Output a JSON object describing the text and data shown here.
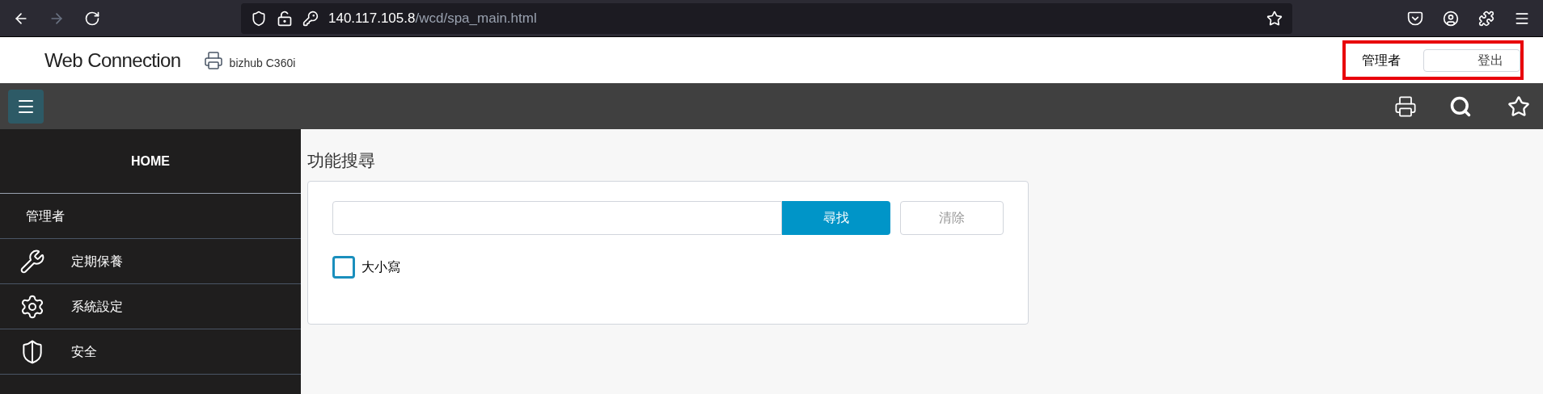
{
  "browser": {
    "url_host": "140.117.105.8",
    "url_path": "/wcd/spa_main.html"
  },
  "header": {
    "brand": "Web Connection",
    "device": "bizhub C360i",
    "user": "管理者",
    "logout": "登出",
    "highlighted": true
  },
  "sidebar": {
    "home": "HOME",
    "section": "管理者",
    "items": [
      {
        "label": "定期保養",
        "kind": "maintenance"
      },
      {
        "label": "系統設定",
        "kind": "system"
      },
      {
        "label": "安全",
        "kind": "security"
      }
    ]
  },
  "main": {
    "title": "功能搜尋",
    "search": {
      "button": "尋找",
      "clear": "清除"
    },
    "option": {
      "label": "大小寫",
      "checked": false
    }
  }
}
